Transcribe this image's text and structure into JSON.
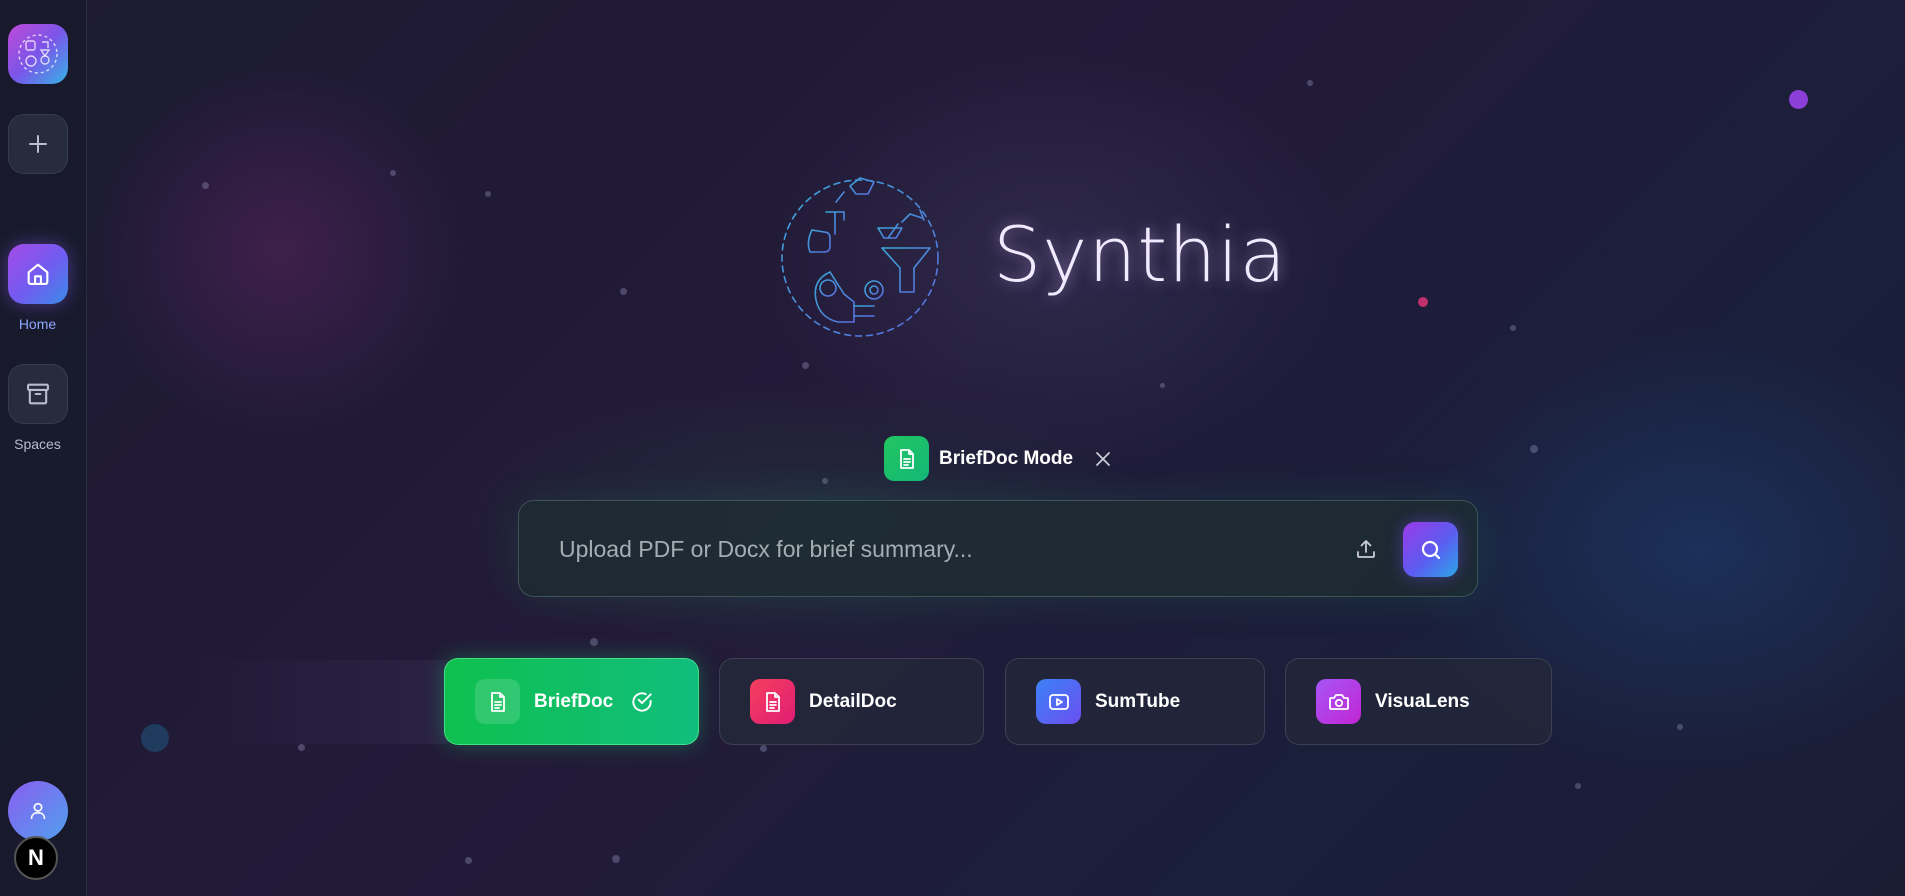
{
  "app": {
    "title": "Synthia"
  },
  "sidebar": {
    "new_icon": "plus-icon",
    "items": [
      {
        "label": "Home",
        "icon": "home-icon",
        "active": true
      },
      {
        "label": "Spaces",
        "icon": "archive-icon",
        "active": false
      }
    ],
    "profile_icon": "user-icon",
    "badge_letter": "N"
  },
  "mode_chip": {
    "label": "BriefDoc Mode",
    "icon": "document-icon",
    "close_icon": "close-icon"
  },
  "search": {
    "placeholder": "Upload PDF or Docx for brief summary...",
    "value": "",
    "upload_icon": "upload-icon",
    "search_icon": "search-icon"
  },
  "modes": [
    {
      "label": "BriefDoc",
      "icon": "document-icon",
      "selected": true,
      "color": "#16c06a"
    },
    {
      "label": "DetailDoc",
      "icon": "document-icon",
      "selected": false,
      "color": "#f43f6e"
    },
    {
      "label": "SumTube",
      "icon": "play-icon",
      "selected": false,
      "color": "#4f63f0"
    },
    {
      "label": "VisuaLens",
      "icon": "camera-icon",
      "selected": false,
      "color": "#a855f7"
    }
  ],
  "colors": {
    "accent_purple": "#8b5cf6",
    "accent_blue": "#3b8de8",
    "accent_green": "#16c06a"
  }
}
